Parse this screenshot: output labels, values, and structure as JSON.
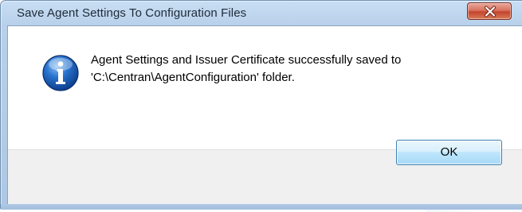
{
  "window": {
    "title": "Save Agent Settings To Configuration Files",
    "close_icon": "close-x-icon"
  },
  "message": {
    "icon": "info-icon",
    "line1": "Agent Settings and Issuer Certificate successfully saved to",
    "line2": "'C:\\Centran\\AgentConfiguration' folder."
  },
  "buttons": {
    "ok_label": "OK"
  },
  "colors": {
    "close_button": "#c4442b",
    "ok_button_border": "#3c7fb1",
    "info_icon": "#1b5fb6",
    "frame": "#adc7e4"
  }
}
